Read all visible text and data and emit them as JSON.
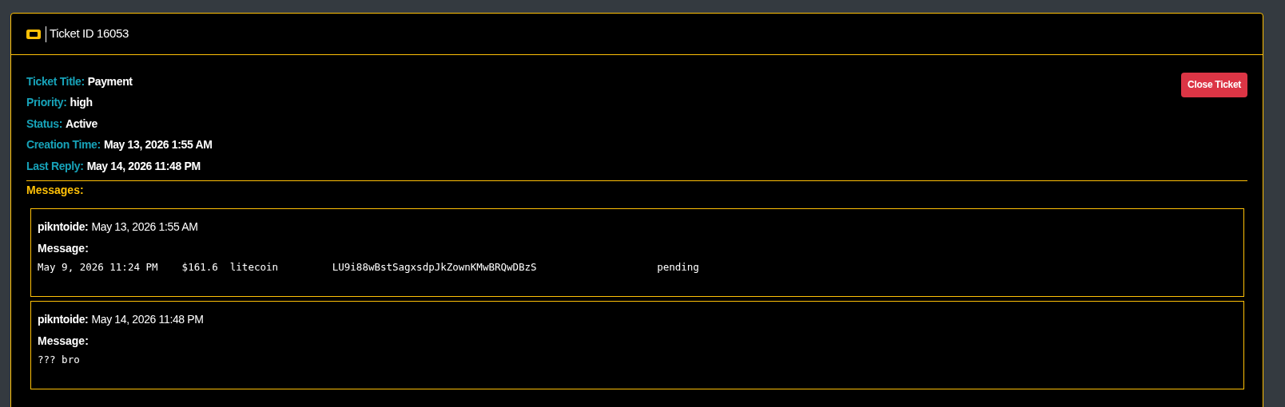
{
  "header": {
    "title": "Ticket ID 16053"
  },
  "details": [
    {
      "label": "Ticket Title:",
      "value": "Payment"
    },
    {
      "label": "Priority:",
      "value": "high"
    },
    {
      "label": "Status:",
      "value": "Active"
    },
    {
      "label": "Creation Time:",
      "value": "May 13, 2026 1:55 AM"
    },
    {
      "label": "Last Reply:",
      "value": "May 14, 2026 11:48 PM"
    }
  ],
  "close_button": "Close Ticket",
  "messages_heading": "Messages:",
  "messages": [
    {
      "author": "pikntoide:",
      "time": "May 13, 2026 1:55 AM",
      "label": "Message:",
      "body": "May 9, 2026 11:24 PM    $161.6  litecoin         LU9i88wBstSagxsdpJkZownKMwBRQwDBzS                    pending"
    },
    {
      "author": "pikntoide:",
      "time": "May 14, 2026 11:48 PM",
      "label": "Message:",
      "body": "??? bro"
    }
  ]
}
